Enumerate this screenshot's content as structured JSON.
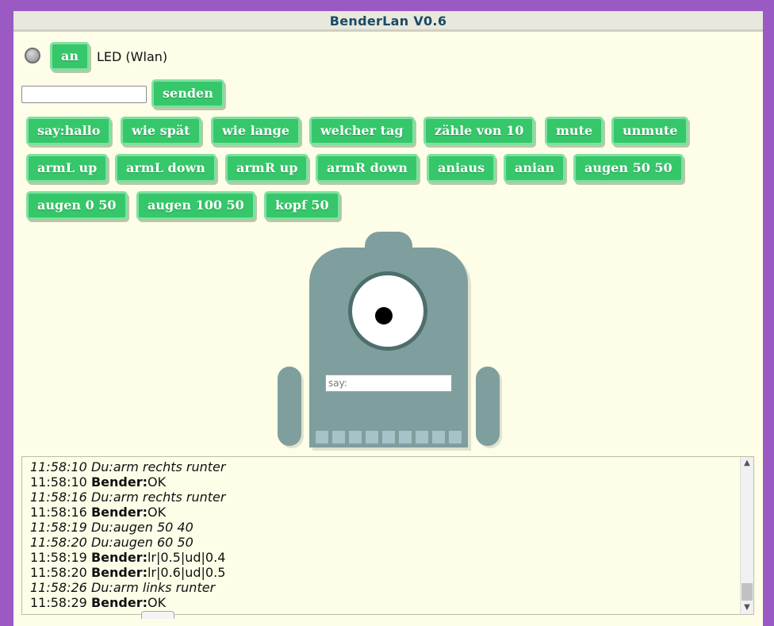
{
  "app": {
    "title": "BenderLan V0.6"
  },
  "led": {
    "button_label": "an",
    "label": "LED (Wlan)"
  },
  "command": {
    "input_value": "",
    "send_label": "senden"
  },
  "buttons_row1": [
    "say:hallo",
    "wie spät",
    "wie lange",
    "welcher tag",
    "zähle von 10",
    "mute",
    "unmute"
  ],
  "buttons_row2": [
    "armL up",
    "armL down",
    "armR up",
    "armR down",
    "aniaus",
    "anian",
    "augen 50 50"
  ],
  "buttons_row3": [
    "augen 0 50",
    "augen 100 50",
    "kopf 50"
  ],
  "robot": {
    "say_placeholder": "say:"
  },
  "log": [
    {
      "time": "11:58:10",
      "speaker": "Du:",
      "text": "arm rechts runter"
    },
    {
      "time": "11:58:10",
      "speaker": "Bender:",
      "text": "OK"
    },
    {
      "time": "11:58:16",
      "speaker": "Du:",
      "text": "arm rechts runter"
    },
    {
      "time": "11:58:16",
      "speaker": "Bender:",
      "text": "OK"
    },
    {
      "time": "11:58:19",
      "speaker": "Du:",
      "text": "augen 50 40"
    },
    {
      "time": "11:58:20",
      "speaker": "Du:",
      "text": "augen 60 50"
    },
    {
      "time": "11:58:19",
      "speaker": "Bender:",
      "text": "lr|0.5|ud|0.4"
    },
    {
      "time": "11:58:20",
      "speaker": "Bender:",
      "text": "lr|0.6|ud|0.5"
    },
    {
      "time": "11:58:26",
      "speaker": "Du:",
      "text": "arm links runter"
    },
    {
      "time": "11:58:29",
      "speaker": "Bender:",
      "text": "OK"
    }
  ],
  "colors": {
    "accent": "#35c76a",
    "panel": "#fdfde8",
    "frame": "#9b59c4",
    "robot": "#7f9e9e"
  }
}
